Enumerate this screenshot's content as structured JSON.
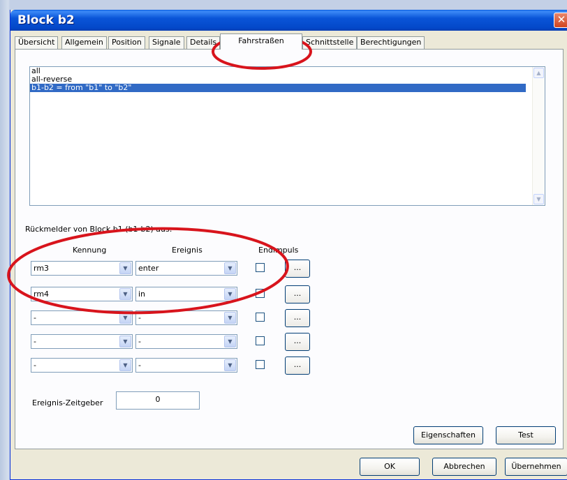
{
  "window": {
    "title": "Block b2",
    "close_glyph": "✕"
  },
  "tabs": [
    {
      "label": "Übersicht"
    },
    {
      "label": "Allgemein"
    },
    {
      "label": "Position"
    },
    {
      "label": "Signale"
    },
    {
      "label": "Details"
    },
    {
      "label": "Fahrstraßen"
    },
    {
      "label": "Schnittstelle"
    },
    {
      "label": "Berechtigungen"
    }
  ],
  "active_tab": "Fahrstraßen",
  "routes": {
    "items": [
      "all",
      "all-reverse",
      "b1-b2 = from \"b1\" to \"b2\""
    ],
    "selected_index": 2
  },
  "sensors": {
    "group_label": "Rückmelder von Block b1 (b1-b2) aus:",
    "headers": {
      "id": "Kennung",
      "event": "Ereignis",
      "endpulse": "Endimpuls"
    },
    "rows": [
      {
        "id": "rm3",
        "event": "enter",
        "endpulse": false,
        "button": "..."
      },
      {
        "id": "rm4",
        "event": "in",
        "endpulse": false,
        "button": "..."
      },
      {
        "id": "-",
        "event": "-",
        "endpulse": false,
        "button": "..."
      },
      {
        "id": "-",
        "event": "-",
        "endpulse": false,
        "button": "..."
      },
      {
        "id": "-",
        "event": "-",
        "endpulse": false,
        "button": "..."
      }
    ]
  },
  "timer": {
    "label": "Ereignis-Zeitgeber",
    "value": "0"
  },
  "panel_buttons": {
    "properties": "Eigenschaften",
    "test": "Test"
  },
  "dialog_buttons": {
    "ok": "OK",
    "cancel": "Abbrechen",
    "apply": "Übernehmen"
  },
  "annotation_color": "#d8141c"
}
